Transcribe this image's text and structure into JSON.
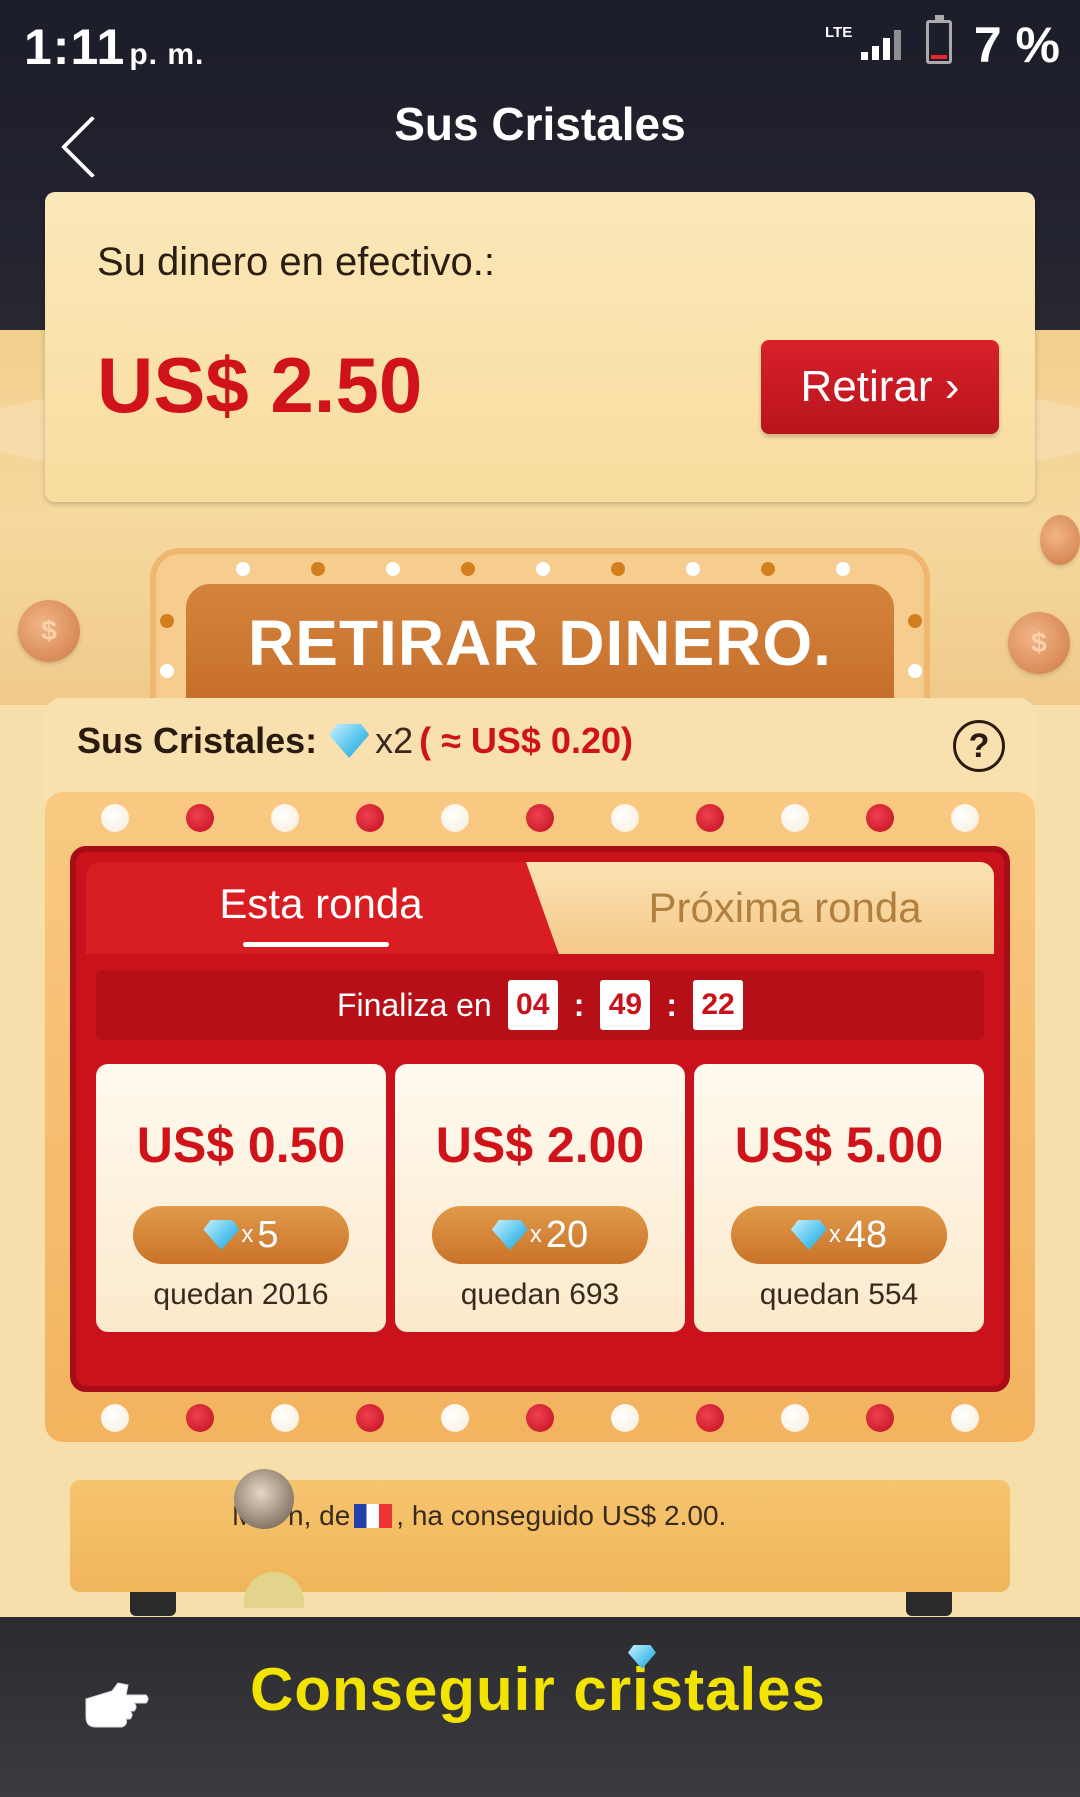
{
  "status_bar": {
    "time": "1:11",
    "ampm": "p. m.",
    "network": "LTE",
    "battery": "7 %"
  },
  "header": {
    "title": "Sus Cristales"
  },
  "cash_card": {
    "label": "Su dinero en efectivo.:",
    "amount": "US$ 2.50",
    "button_label": "Retirar ›"
  },
  "banner": {
    "title": "RETIRAR DINERO."
  },
  "crystals": {
    "label": "Sus Cristales:",
    "count": "x2",
    "equiv": "( ≈ US$ 0.20)"
  },
  "tabs": [
    {
      "label": "Esta ronda"
    },
    {
      "label": "Próxima ronda"
    }
  ],
  "timer": {
    "label": "Finaliza en",
    "hours": "04",
    "minutes": "49",
    "seconds": "22"
  },
  "offers": [
    {
      "amount": "US$ 0.50",
      "cost": "5",
      "remaining": "quedan 2016"
    },
    {
      "amount": "US$ 2.00",
      "cost": "20",
      "remaining": "quedan 693"
    },
    {
      "amount": "US$ 5.00",
      "cost": "48",
      "remaining": "quedan 554"
    }
  ],
  "feed": {
    "message_before": "M***n, de",
    "message_after": ", ha conseguido US$ 2.00."
  },
  "bottom": {
    "cta": "Conseguir cristales"
  },
  "colors": {
    "accent_red": "#d0121a",
    "cta_yellow": "#f2e400",
    "crystal_blue": "#52c2ec"
  }
}
